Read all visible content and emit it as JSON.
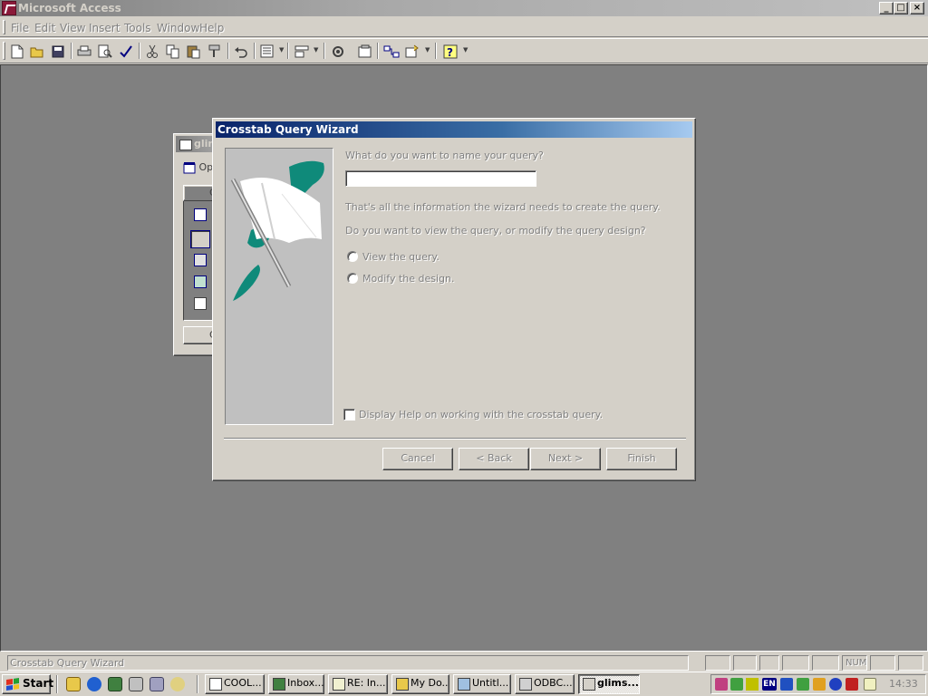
{
  "app": {
    "title": "Microsoft Access",
    "caption_buttons": {
      "minimize": "_",
      "maximize": "□",
      "close": "×"
    }
  },
  "menu": {
    "items": [
      "File",
      "Edit",
      "View",
      "Insert",
      "Tools",
      "Window",
      "Help"
    ]
  },
  "toolbar": {
    "buttons": [
      "new-icon",
      "open-icon",
      "save-icon",
      "print-icon",
      "print-preview-icon",
      "spelling-icon",
      "cut-icon",
      "copy-icon",
      "paste-icon",
      "format-painter-icon",
      "undo-icon",
      "office-links-icon",
      "analyze-icon",
      "properties-icon",
      "relationships-icon",
      "new-object-icon",
      "help-icon"
    ]
  },
  "db_window": {
    "title": "glin",
    "open_label": "Op",
    "tab_label": "C",
    "bottom_label": "C"
  },
  "wizard": {
    "title": "Crosstab Query Wizard",
    "name_prompt": "What do you want to name your query?",
    "name_value": "",
    "info_text": "That's all the information the wizard needs to create the query.",
    "view_prompt": "Do you want to view the query, or modify the query design?",
    "option_view": "View the query.",
    "option_modify": "Modify the design.",
    "help_checkbox": "Display Help on working with the crosstab query.",
    "buttons": {
      "cancel": "Cancel",
      "back": "< Back",
      "next": "Next >",
      "finish": "Finish"
    }
  },
  "statusbar": {
    "text": "Crosstab Query Wizard",
    "num": "NUM"
  },
  "taskbar": {
    "start": "Start",
    "tasks": [
      {
        "label": "COOL...",
        "active": false
      },
      {
        "label": "Inbox...",
        "active": false
      },
      {
        "label": "RE: In...",
        "active": false
      },
      {
        "label": "My Do...",
        "active": false
      },
      {
        "label": "Untitl...",
        "active": false
      },
      {
        "label": "ODBC...",
        "active": false
      },
      {
        "label": "glims...",
        "active": true
      }
    ],
    "tray_lang": "EN",
    "clock": "14:33"
  },
  "colors": {
    "face": "#d4d0c8",
    "mdi_background": "#808080",
    "dialog_title_start": "#0a246a",
    "dialog_title_end": "#a6caf0",
    "wizard_art_teal": "#0f8a7a"
  }
}
